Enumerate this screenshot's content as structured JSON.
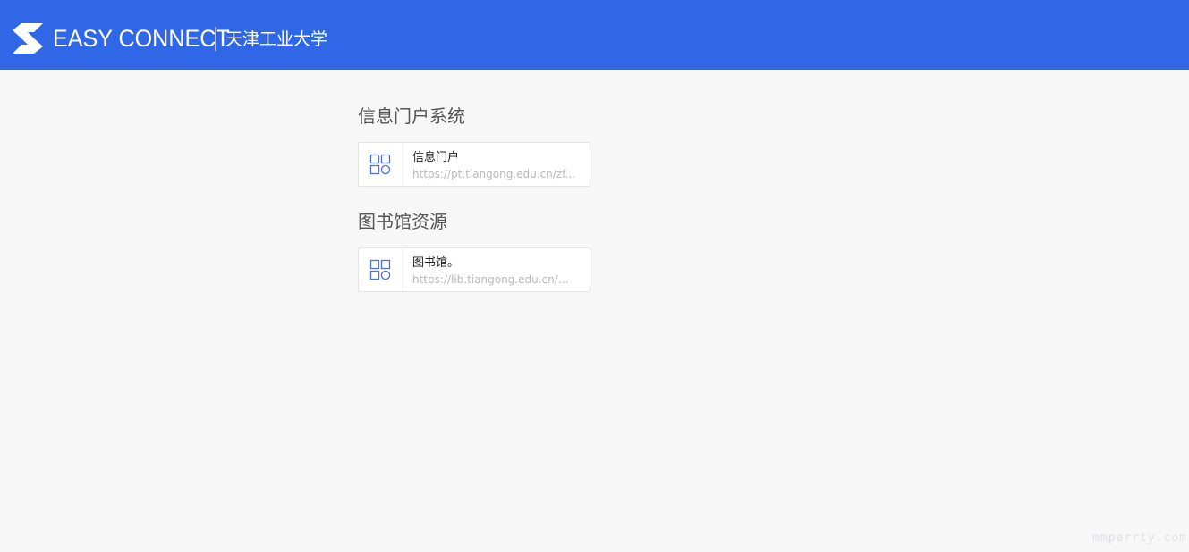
{
  "header": {
    "brand": "EASY CONNECT",
    "organization": "天津工业大学",
    "background_color": "#3067e6",
    "logo_icon": "easyconnect-logo-icon"
  },
  "sections": [
    {
      "title": "信息门户系统",
      "resources": [
        {
          "name": "信息门户",
          "url": "https://pt.tiangong.edu.cn/zf...",
          "icon": "app-grid-icon"
        }
      ]
    },
    {
      "title": "图书馆资源",
      "resources": [
        {
          "name": "图书馆。",
          "url": "https://lib.tiangong.edu.cn/m...",
          "icon": "app-grid-icon"
        }
      ]
    }
  ],
  "watermark": "mmperrty.com",
  "colors": {
    "accent": "#3067e6",
    "icon": "#4a72d8",
    "page_background": "#f7f7f7"
  }
}
